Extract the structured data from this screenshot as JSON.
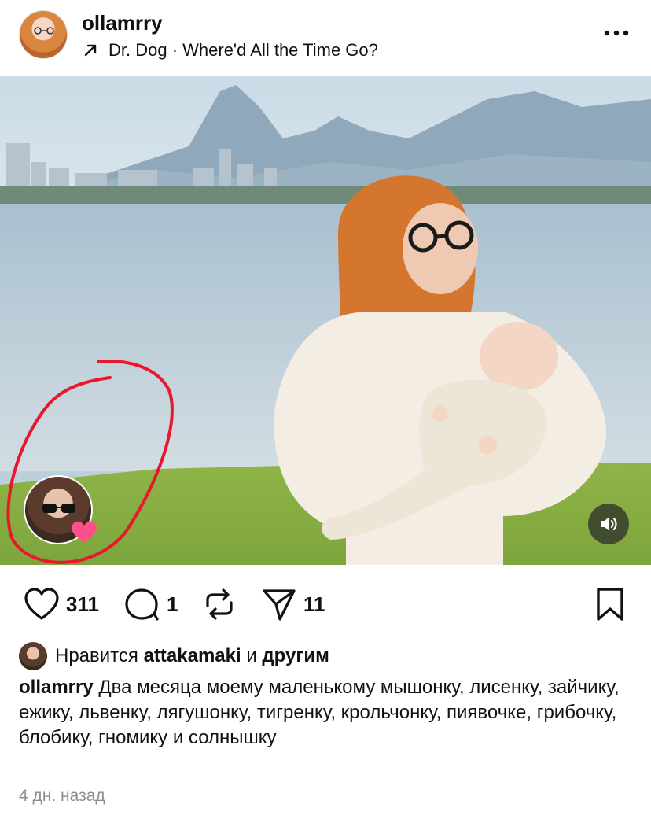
{
  "post": {
    "username": "ollamrry",
    "music": "Dr. Dog · Where'd All the Time Go?",
    "icons": {
      "music_arrow": "arrow-up-right-icon",
      "more": "more-horizontal-icon",
      "sound": "speaker-icon",
      "tag_badge": "heart-icon"
    }
  },
  "actions": {
    "likes_count": "311",
    "comments_count": "1",
    "shares_count": "11"
  },
  "likes_line": {
    "prefix": "Нравится",
    "user": "attakamaki",
    "conjunction": "и",
    "others": "другим"
  },
  "caption": {
    "username": "ollamrry",
    "text": "Два месяца моему маленькому мышонку, лисенку, зайчику, ежику, львенку, лягушонку, тигренку, крольчонку, пиявочке, грибочку, блобику, гномику и солнышку"
  },
  "timestamp": "4 дн. назад",
  "colors": {
    "annotation_circle": "#e8182c",
    "heart_badge": "#ff4f8b"
  }
}
